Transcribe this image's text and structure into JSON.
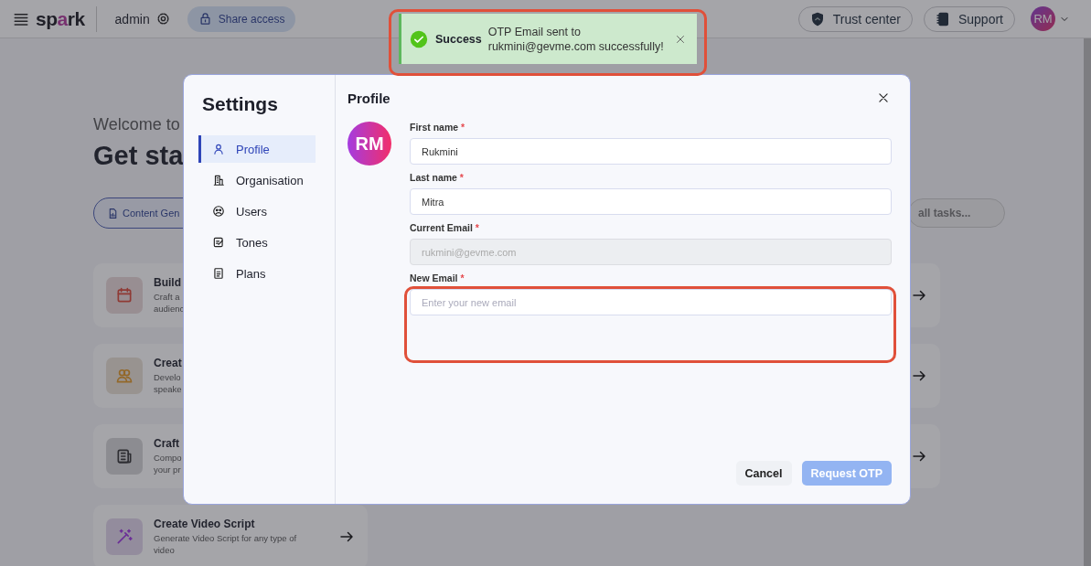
{
  "header": {
    "logo": [
      {
        "text": "sp",
        "accent": false
      },
      {
        "text": "a",
        "accent": true
      },
      {
        "text": "rk",
        "accent": false
      }
    ],
    "workspace": "admin",
    "share_button": "Share access",
    "trust_center": "Trust center",
    "support": "Support",
    "avatar": "RM"
  },
  "page": {
    "welcome": "Welcome to",
    "heading": "Get sta",
    "filter_chip": "Content Gen",
    "search": {
      "placeholder": "all tasks..."
    },
    "cards": [
      {
        "kind": "task",
        "title": "Build",
        "lines": [
          "Craft a",
          "audienc"
        ],
        "color": "#8f3a35",
        "arrow": false
      },
      {
        "kind": "partial",
        "arrow": true
      },
      {
        "kind": "task",
        "title": "Creat",
        "lines": [
          "Develo",
          "speake"
        ],
        "color": "#936829",
        "arrow": false
      },
      {
        "kind": "partial",
        "arrow": true
      },
      {
        "kind": "task",
        "title": "Craft",
        "lines": [
          "Compo",
          "your pr"
        ],
        "color": "#2e2e33",
        "arrow": false
      },
      {
        "kind": "partial",
        "arrow": true
      },
      {
        "kind": "task",
        "title": "Create Video Script",
        "lines": [
          "Generate Video Script for any type of",
          "video"
        ],
        "color": "#6b2d97",
        "arrow": true
      }
    ]
  },
  "toast": {
    "title": "Success",
    "message": [
      "OTP Email sent to",
      "rukmini@gevme.com successfully!"
    ]
  },
  "settings": {
    "title": "Settings",
    "nav": [
      {
        "label": "Profile",
        "selected": true
      },
      {
        "label": "Organisation",
        "selected": false
      },
      {
        "label": "Users",
        "selected": false
      },
      {
        "label": "Tones",
        "selected": false
      },
      {
        "label": "Plans",
        "selected": false
      }
    ],
    "section_title": "Profile",
    "avatar": "RM",
    "required_mark": "*",
    "fields": [
      {
        "label": "First name",
        "required": true,
        "value": "Rukmini",
        "disabled": false
      },
      {
        "label": "Last name",
        "required": true,
        "value": "Mitra",
        "disabled": false
      },
      {
        "label": "Current Email",
        "required": true,
        "value": "rukmini@gevme.com",
        "disabled": true
      },
      {
        "label": "New Email",
        "required": true,
        "placeholder": "Enter your new email",
        "disabled": false
      }
    ],
    "buttons": [
      {
        "label": "Cancel",
        "kind": "secondary",
        "disabled": false
      },
      {
        "label": "Request OTP",
        "kind": "primary",
        "disabled": true
      }
    ]
  }
}
